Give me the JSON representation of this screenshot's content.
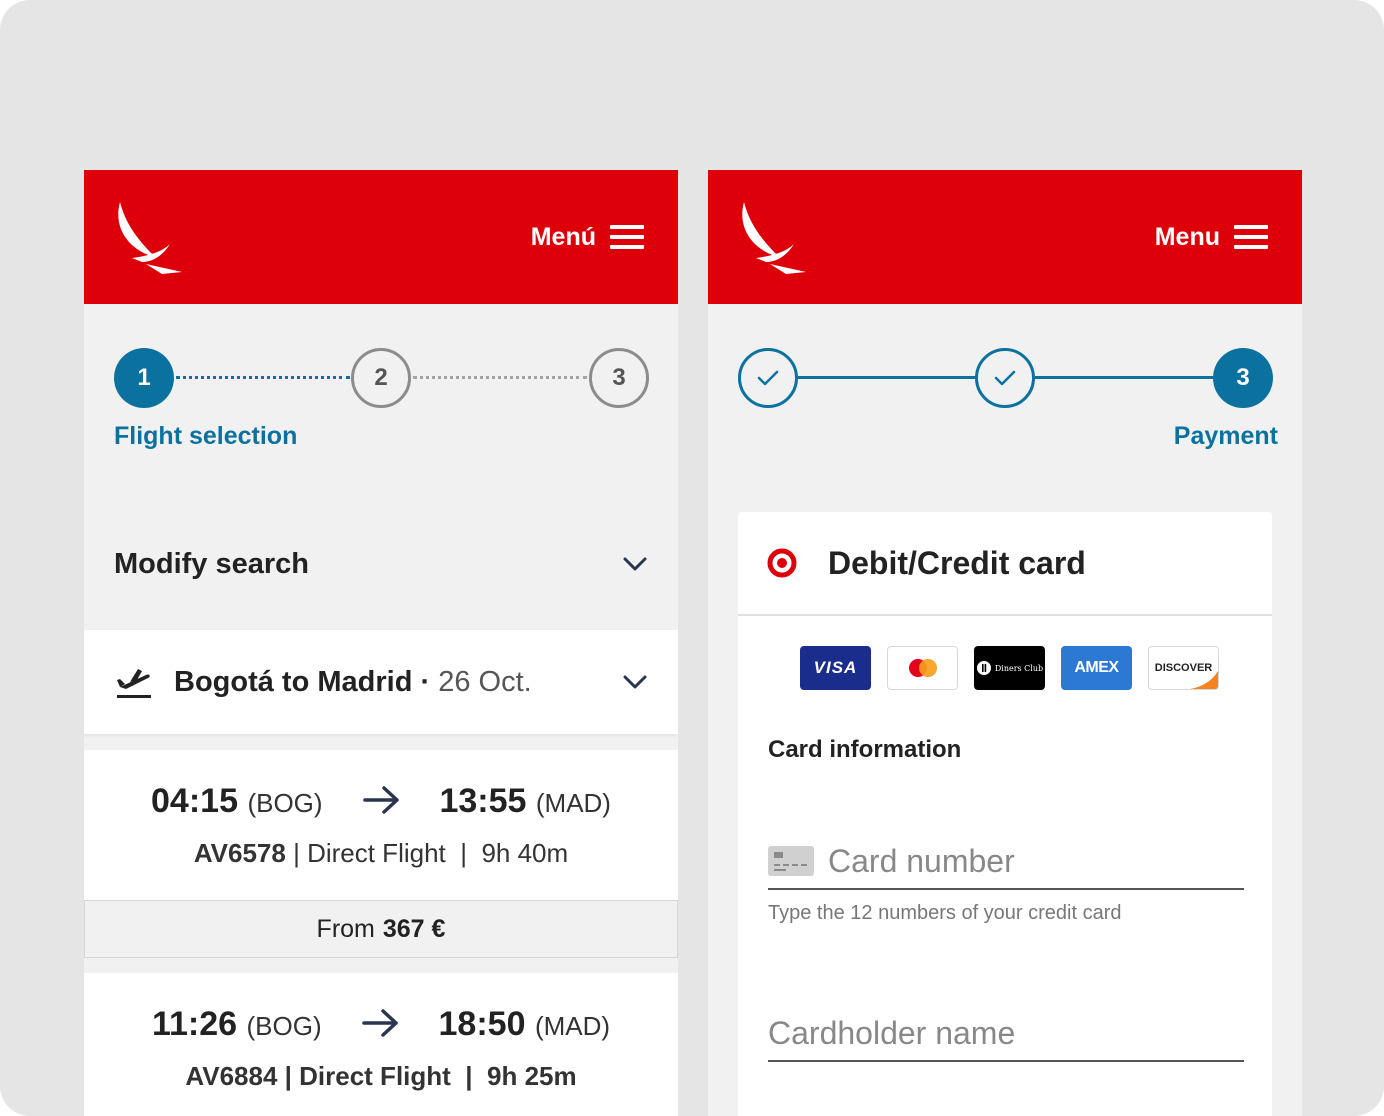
{
  "left_screen": {
    "menu_label": "Menú",
    "steps": [
      "1",
      "2",
      "3"
    ],
    "step_caption": "Flight selection",
    "modify_search": "Modify search",
    "route": {
      "title": "Bogotá to Madrid",
      "separator": "·",
      "date": "26 Oct."
    },
    "flights": [
      {
        "dep_time": "04:15",
        "dep_code": "(BOG)",
        "arr_time": "13:55",
        "arr_code": "(MAD)",
        "number": "AV6578",
        "type": "Direct Flight",
        "duration": "9h 40m",
        "price_prefix": "From",
        "price": "367 €"
      },
      {
        "dep_time": "11:26",
        "dep_code": "(BOG)",
        "arr_time": "18:50",
        "arr_code": "(MAD)",
        "number": "AV6884",
        "type": "Direct Flight",
        "duration": "9h 25m"
      }
    ]
  },
  "right_screen": {
    "menu_label": "Menu",
    "current_step": "3",
    "step_caption": "Payment",
    "payment_method": "Debit/Credit card",
    "card_brands": [
      "VISA",
      "mastercard",
      "Diners Club",
      "AMEX",
      "DISCOVER"
    ],
    "card_information_label": "Card information",
    "card_number_placeholder": "Card number",
    "card_number_helper": "Type the 12 numbers of your credit card",
    "cardholder_placeholder": "Cardholder name"
  },
  "colors": {
    "brand_red": "#dd000a",
    "accent_blue": "#0b72a0",
    "background": "#f1f1f1"
  }
}
